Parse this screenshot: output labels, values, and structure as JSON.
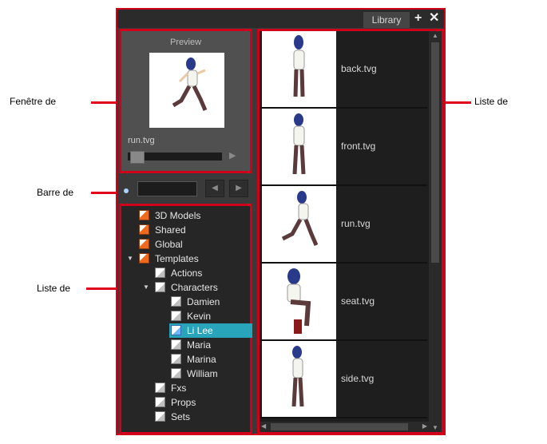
{
  "callouts": {
    "preview_window": "Fenêtre de",
    "search_bar": "Barre de",
    "folder_list": "Liste de",
    "template_list": "Liste de"
  },
  "panel": {
    "tab_label": "Library",
    "add_icon": "plus-icon",
    "close_icon": "close-icon"
  },
  "preview": {
    "label": "Preview",
    "file_name": "run.tvg",
    "play_icon": "play-icon"
  },
  "search": {
    "value": "",
    "prev_icon": "chevron-left-icon",
    "next_icon": "chevron-right-icon"
  },
  "tree": {
    "items": [
      {
        "label": "3D Models",
        "depth": 0,
        "icon": "folder-orange",
        "expand": ""
      },
      {
        "label": "Shared",
        "depth": 0,
        "icon": "folder-orange",
        "expand": ""
      },
      {
        "label": "Global",
        "depth": 0,
        "icon": "folder-orange",
        "expand": ""
      },
      {
        "label": "Templates",
        "depth": 0,
        "icon": "folder-orange",
        "expand": "open"
      },
      {
        "label": "Actions",
        "depth": 1,
        "icon": "folder-white",
        "expand": ""
      },
      {
        "label": "Characters",
        "depth": 1,
        "icon": "folder-white",
        "expand": "open"
      },
      {
        "label": "Damien",
        "depth": 2,
        "icon": "folder-white",
        "expand": ""
      },
      {
        "label": "Kevin",
        "depth": 2,
        "icon": "folder-white",
        "expand": ""
      },
      {
        "label": "Li Lee",
        "depth": 2,
        "icon": "folder-blue",
        "expand": "",
        "selected": true
      },
      {
        "label": "Maria",
        "depth": 2,
        "icon": "folder-white",
        "expand": ""
      },
      {
        "label": "Marina",
        "depth": 2,
        "icon": "folder-white",
        "expand": ""
      },
      {
        "label": "William",
        "depth": 2,
        "icon": "folder-white",
        "expand": ""
      },
      {
        "label": "Fxs",
        "depth": 1,
        "icon": "folder-white",
        "expand": ""
      },
      {
        "label": "Props",
        "depth": 1,
        "icon": "folder-white",
        "expand": ""
      },
      {
        "label": "Sets",
        "depth": 1,
        "icon": "folder-white",
        "expand": ""
      }
    ]
  },
  "templates": {
    "items": [
      {
        "label": "back.tvg",
        "pose": "standing-back"
      },
      {
        "label": "front.tvg",
        "pose": "standing-front"
      },
      {
        "label": "run.tvg",
        "pose": "running"
      },
      {
        "label": "seat.tvg",
        "pose": "seated"
      },
      {
        "label": "side.tvg",
        "pose": "standing-side"
      }
    ]
  },
  "colors": {
    "highlight_red": "#d0001a",
    "selection": "#29a5bb",
    "panel_bg": "#3a3a3a"
  }
}
